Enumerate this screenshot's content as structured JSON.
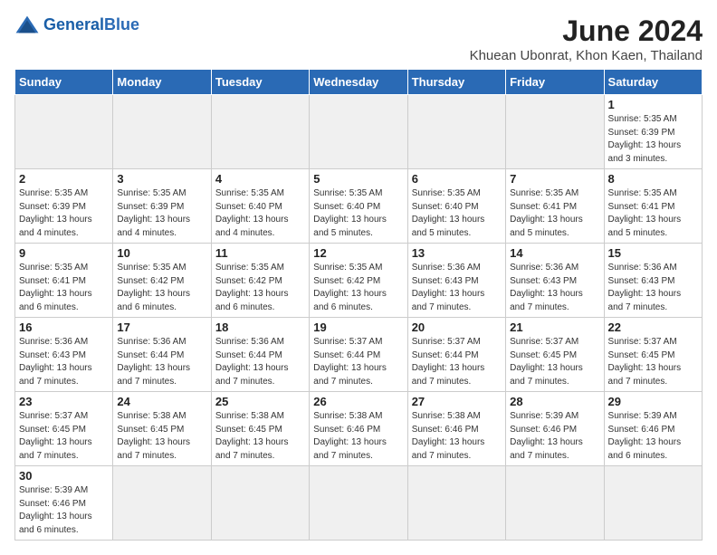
{
  "header": {
    "logo_general": "General",
    "logo_blue": "Blue",
    "month_title": "June 2024",
    "location": "Khuean Ubonrat, Khon Kaen, Thailand"
  },
  "weekdays": [
    "Sunday",
    "Monday",
    "Tuesday",
    "Wednesday",
    "Thursday",
    "Friday",
    "Saturday"
  ],
  "weeks": [
    [
      {
        "day": "",
        "info": ""
      },
      {
        "day": "",
        "info": ""
      },
      {
        "day": "",
        "info": ""
      },
      {
        "day": "",
        "info": ""
      },
      {
        "day": "",
        "info": ""
      },
      {
        "day": "",
        "info": ""
      },
      {
        "day": "1",
        "info": "Sunrise: 5:35 AM\nSunset: 6:39 PM\nDaylight: 13 hours\nand 3 minutes."
      }
    ],
    [
      {
        "day": "2",
        "info": "Sunrise: 5:35 AM\nSunset: 6:39 PM\nDaylight: 13 hours\nand 4 minutes."
      },
      {
        "day": "3",
        "info": "Sunrise: 5:35 AM\nSunset: 6:39 PM\nDaylight: 13 hours\nand 4 minutes."
      },
      {
        "day": "4",
        "info": "Sunrise: 5:35 AM\nSunset: 6:40 PM\nDaylight: 13 hours\nand 4 minutes."
      },
      {
        "day": "5",
        "info": "Sunrise: 5:35 AM\nSunset: 6:40 PM\nDaylight: 13 hours\nand 5 minutes."
      },
      {
        "day": "6",
        "info": "Sunrise: 5:35 AM\nSunset: 6:40 PM\nDaylight: 13 hours\nand 5 minutes."
      },
      {
        "day": "7",
        "info": "Sunrise: 5:35 AM\nSunset: 6:41 PM\nDaylight: 13 hours\nand 5 minutes."
      },
      {
        "day": "8",
        "info": "Sunrise: 5:35 AM\nSunset: 6:41 PM\nDaylight: 13 hours\nand 5 minutes."
      }
    ],
    [
      {
        "day": "9",
        "info": "Sunrise: 5:35 AM\nSunset: 6:41 PM\nDaylight: 13 hours\nand 6 minutes."
      },
      {
        "day": "10",
        "info": "Sunrise: 5:35 AM\nSunset: 6:42 PM\nDaylight: 13 hours\nand 6 minutes."
      },
      {
        "day": "11",
        "info": "Sunrise: 5:35 AM\nSunset: 6:42 PM\nDaylight: 13 hours\nand 6 minutes."
      },
      {
        "day": "12",
        "info": "Sunrise: 5:35 AM\nSunset: 6:42 PM\nDaylight: 13 hours\nand 6 minutes."
      },
      {
        "day": "13",
        "info": "Sunrise: 5:36 AM\nSunset: 6:43 PM\nDaylight: 13 hours\nand 7 minutes."
      },
      {
        "day": "14",
        "info": "Sunrise: 5:36 AM\nSunset: 6:43 PM\nDaylight: 13 hours\nand 7 minutes."
      },
      {
        "day": "15",
        "info": "Sunrise: 5:36 AM\nSunset: 6:43 PM\nDaylight: 13 hours\nand 7 minutes."
      }
    ],
    [
      {
        "day": "16",
        "info": "Sunrise: 5:36 AM\nSunset: 6:43 PM\nDaylight: 13 hours\nand 7 minutes."
      },
      {
        "day": "17",
        "info": "Sunrise: 5:36 AM\nSunset: 6:44 PM\nDaylight: 13 hours\nand 7 minutes."
      },
      {
        "day": "18",
        "info": "Sunrise: 5:36 AM\nSunset: 6:44 PM\nDaylight: 13 hours\nand 7 minutes."
      },
      {
        "day": "19",
        "info": "Sunrise: 5:37 AM\nSunset: 6:44 PM\nDaylight: 13 hours\nand 7 minutes."
      },
      {
        "day": "20",
        "info": "Sunrise: 5:37 AM\nSunset: 6:44 PM\nDaylight: 13 hours\nand 7 minutes."
      },
      {
        "day": "21",
        "info": "Sunrise: 5:37 AM\nSunset: 6:45 PM\nDaylight: 13 hours\nand 7 minutes."
      },
      {
        "day": "22",
        "info": "Sunrise: 5:37 AM\nSunset: 6:45 PM\nDaylight: 13 hours\nand 7 minutes."
      }
    ],
    [
      {
        "day": "23",
        "info": "Sunrise: 5:37 AM\nSunset: 6:45 PM\nDaylight: 13 hours\nand 7 minutes."
      },
      {
        "day": "24",
        "info": "Sunrise: 5:38 AM\nSunset: 6:45 PM\nDaylight: 13 hours\nand 7 minutes."
      },
      {
        "day": "25",
        "info": "Sunrise: 5:38 AM\nSunset: 6:45 PM\nDaylight: 13 hours\nand 7 minutes."
      },
      {
        "day": "26",
        "info": "Sunrise: 5:38 AM\nSunset: 6:46 PM\nDaylight: 13 hours\nand 7 minutes."
      },
      {
        "day": "27",
        "info": "Sunrise: 5:38 AM\nSunset: 6:46 PM\nDaylight: 13 hours\nand 7 minutes."
      },
      {
        "day": "28",
        "info": "Sunrise: 5:39 AM\nSunset: 6:46 PM\nDaylight: 13 hours\nand 7 minutes."
      },
      {
        "day": "29",
        "info": "Sunrise: 5:39 AM\nSunset: 6:46 PM\nDaylight: 13 hours\nand 6 minutes."
      }
    ],
    [
      {
        "day": "30",
        "info": "Sunrise: 5:39 AM\nSunset: 6:46 PM\nDaylight: 13 hours\nand 6 minutes."
      },
      {
        "day": "",
        "info": ""
      },
      {
        "day": "",
        "info": ""
      },
      {
        "day": "",
        "info": ""
      },
      {
        "day": "",
        "info": ""
      },
      {
        "day": "",
        "info": ""
      },
      {
        "day": "",
        "info": ""
      }
    ]
  ]
}
